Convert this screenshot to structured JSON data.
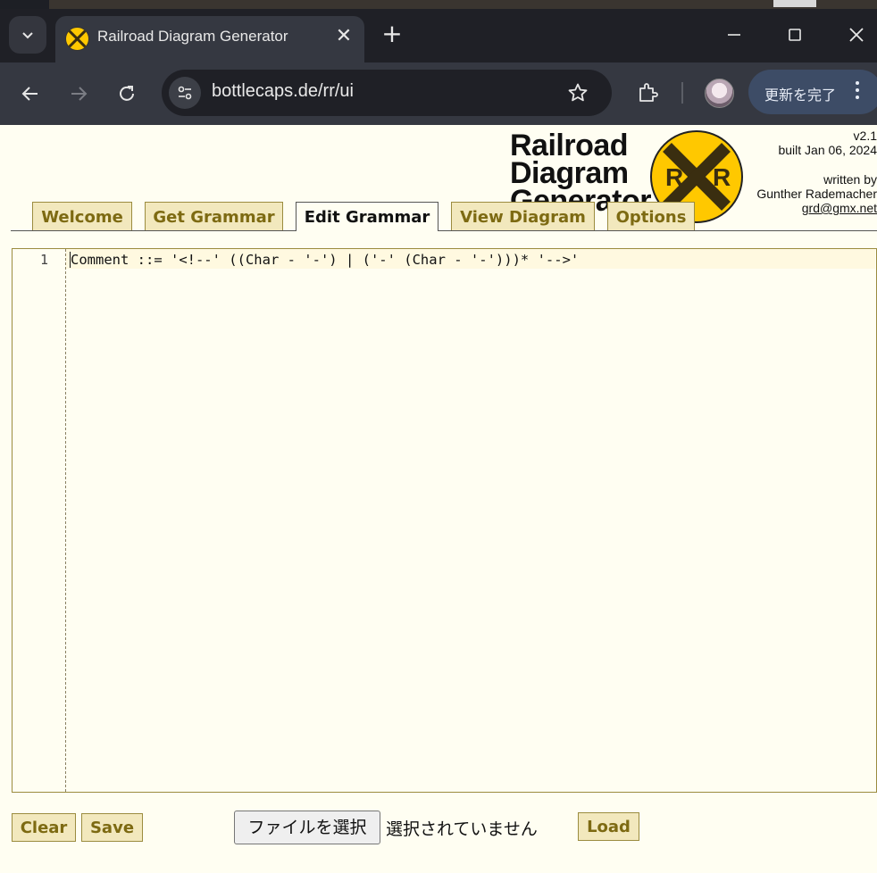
{
  "browser": {
    "tab": {
      "title": "Railroad Diagram Generator",
      "favicon": "railroad-crossing-icon"
    },
    "address": {
      "url": "bottlecaps.de/rr/ui"
    },
    "update_button": "更新を完了"
  },
  "header": {
    "logo_lines": [
      "Railroad",
      "Diagram",
      "Generator"
    ],
    "logo_sign_letters": [
      "R",
      "R"
    ],
    "version": "v2.1",
    "built": "built Jan 06, 2024",
    "written_by": "written by",
    "author": "Gunther Rademacher",
    "email": "grd@gmx.net"
  },
  "tabs": [
    {
      "label": "Welcome",
      "active": false
    },
    {
      "label": "Get Grammar",
      "active": false
    },
    {
      "label": "Edit Grammar",
      "active": true
    },
    {
      "label": "View Diagram",
      "active": false
    },
    {
      "label": "Options",
      "active": false
    }
  ],
  "editor": {
    "line_number": "1",
    "code": "Comment ::= '<!--' ((Char - '-') | ('-' (Char - '-')))* '-->'"
  },
  "buttons": {
    "clear": "Clear",
    "save": "Save",
    "choose_file": "ファイルを選択",
    "file_status": "選択されていません",
    "load": "Load"
  },
  "colors": {
    "page_bg": "#fffef2",
    "tab_bg": "#f2e8bd",
    "tab_text": "#7d6a12",
    "sign_yellow": "#ffc800",
    "browser_dark": "#1f2026",
    "browser_toolbar": "#353841"
  }
}
